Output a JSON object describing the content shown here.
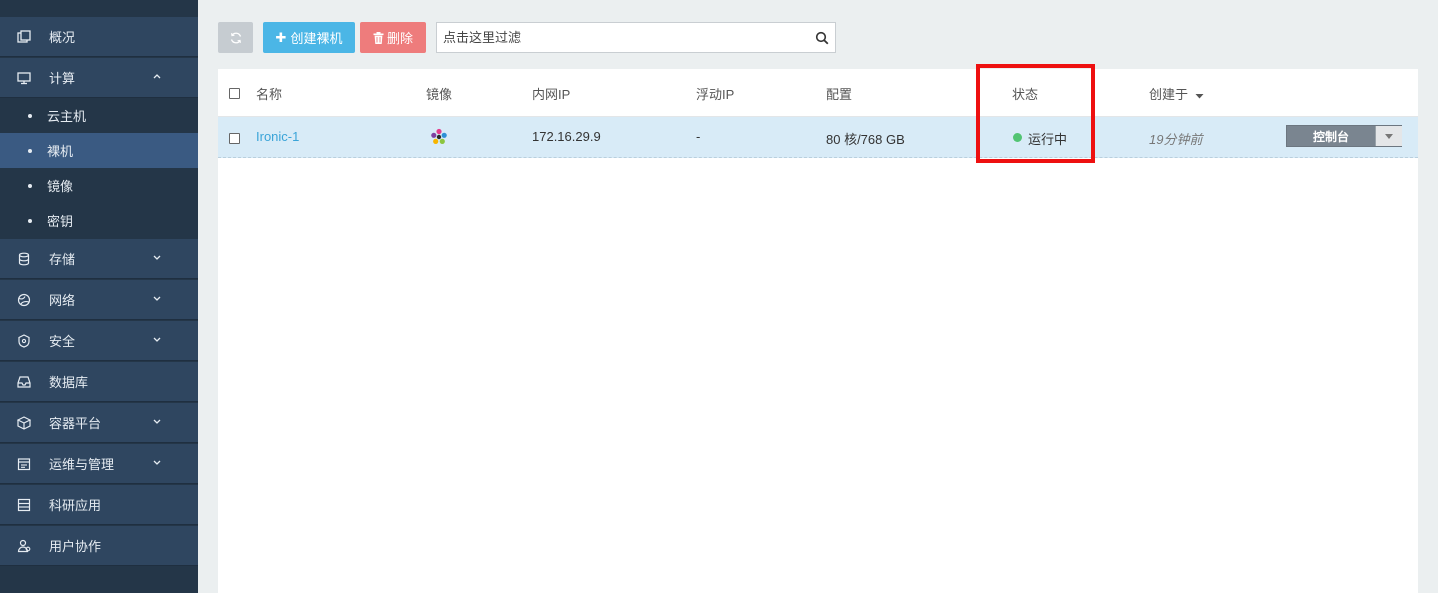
{
  "sidebar": {
    "items": [
      {
        "label": "概况",
        "icon": "overview-icon"
      },
      {
        "label": "计算",
        "icon": "monitor-icon",
        "expanded": true,
        "children": [
          {
            "label": "云主机"
          },
          {
            "label": "裸机",
            "active": true
          },
          {
            "label": "镜像"
          },
          {
            "label": "密钥"
          }
        ]
      },
      {
        "label": "存储",
        "icon": "database-icon"
      },
      {
        "label": "网络",
        "icon": "globe-icon"
      },
      {
        "label": "安全",
        "icon": "shield-icon"
      },
      {
        "label": "数据库",
        "icon": "inbox-icon"
      },
      {
        "label": "容器平台",
        "icon": "container-icon"
      },
      {
        "label": "运维与管理",
        "icon": "calendar-icon"
      },
      {
        "label": "科研应用",
        "icon": "server-icon"
      },
      {
        "label": "用户协作",
        "icon": "users-icon"
      }
    ]
  },
  "toolbar": {
    "create_label": "创建裸机",
    "delete_label": "删除",
    "search_placeholder": "点击这里过滤"
  },
  "table": {
    "columns": [
      "名称",
      "镜像",
      "内网IP",
      "浮动IP",
      "配置",
      "状态",
      "创建于"
    ],
    "rows": [
      {
        "name": "Ironic-1",
        "image_icon": "os-logo-icon",
        "private_ip": "172.16.29.9",
        "floating_ip": "-",
        "config": "80 核/768 GB",
        "status": "运行中",
        "created": "19分钟前",
        "action": "控制台"
      }
    ]
  },
  "colors": {
    "sidebar_bg": "#243648",
    "accent_blue": "#4bb6e6",
    "danger_red": "#ee7c7c",
    "status_green": "#52c473",
    "highlight_red": "#ee1010"
  }
}
